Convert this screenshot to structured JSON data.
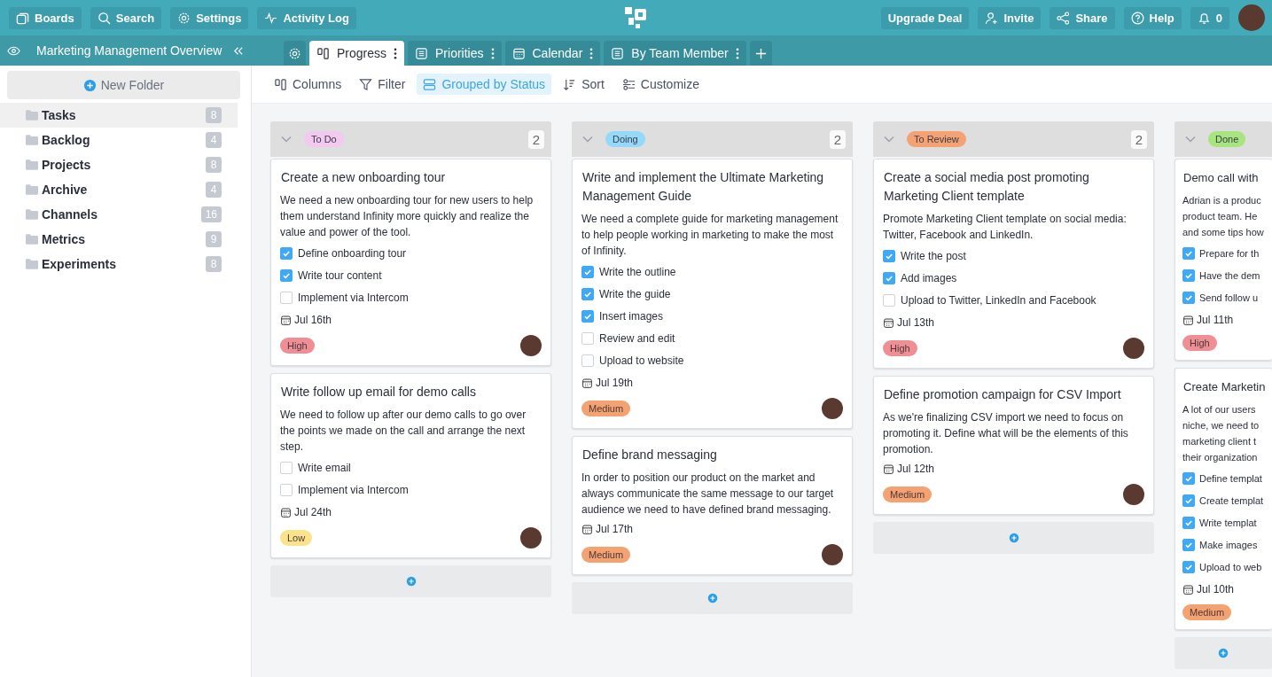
{
  "topbar": {
    "left": [
      {
        "label": "Boards",
        "kind": "boards"
      },
      {
        "label": "Search",
        "kind": "search"
      },
      {
        "label": "Settings",
        "kind": "settings"
      },
      {
        "label": "Activity Log",
        "kind": "activity"
      }
    ],
    "right": [
      {
        "label": "Upgrade Deal",
        "kind": "plain"
      },
      {
        "label": "Invite",
        "kind": "invite"
      },
      {
        "label": "Share",
        "kind": "share"
      },
      {
        "label": "Help",
        "kind": "help"
      },
      {
        "label": "0",
        "kind": "bell"
      }
    ]
  },
  "workspace": {
    "title": "Marketing Management Overview"
  },
  "tabs": [
    {
      "label": "Progress",
      "kind": "board",
      "selected": true
    },
    {
      "label": "Priorities",
      "kind": "list",
      "selected": false
    },
    {
      "label": "Calendar",
      "kind": "calendar",
      "selected": false
    },
    {
      "label": "By Team Member",
      "kind": "list",
      "selected": false
    }
  ],
  "sidebar": {
    "new_folder": "New Folder",
    "items": [
      {
        "label": "Tasks",
        "count": "8",
        "selected": true
      },
      {
        "label": "Backlog",
        "count": "4",
        "selected": false
      },
      {
        "label": "Projects",
        "count": "8",
        "selected": false
      },
      {
        "label": "Archive",
        "count": "4",
        "selected": false
      },
      {
        "label": "Channels",
        "count": "16",
        "selected": false
      },
      {
        "label": "Metrics",
        "count": "9",
        "selected": false
      },
      {
        "label": "Experiments",
        "count": "8",
        "selected": false
      }
    ]
  },
  "toolbar": [
    {
      "label": "Columns",
      "kind": "columns",
      "selected": false
    },
    {
      "label": "Filter",
      "kind": "filter",
      "selected": false
    },
    {
      "label": "Grouped by Status",
      "kind": "group",
      "selected": true
    },
    {
      "label": "Sort",
      "kind": "sort",
      "selected": false
    },
    {
      "label": "Customize",
      "kind": "customize",
      "selected": false
    }
  ],
  "columns": [
    {
      "status": "To Do",
      "color": "#f3c9ef",
      "count": "2",
      "cards": [
        {
          "title": "Create a new onboarding tour",
          "description": [
            "We need a new onboarding tour for new users to help them understand Infinity more quickly and realize the value and power of the tool."
          ],
          "checklist": [
            {
              "label": "Define onboarding tour",
              "checked": true
            },
            {
              "label": "Write tour content",
              "checked": true
            },
            {
              "label": "Implement via Intercom",
              "checked": false
            }
          ],
          "date": "Jul 16th",
          "priority": {
            "label": "High",
            "color": "#ef8f95"
          }
        },
        {
          "title": "Write follow up email for demo calls",
          "description": [
            "We need to follow up after our demo calls to go over the points we made on the call and arrange the next step."
          ],
          "checklist": [
            {
              "label": "Write email",
              "checked": false
            },
            {
              "label": "Implement via Intercom",
              "checked": false
            }
          ],
          "date": "Jul 24th",
          "priority": {
            "label": "Low",
            "color": "#fbe38e"
          }
        }
      ]
    },
    {
      "status": "Doing",
      "color": "#94d9f7",
      "count": "2",
      "cards": [
        {
          "title": "Write and implement the Ultimate Marketing Management Guide",
          "description": [
            "We need a complete guide for marketing management to help people working in marketing to make the most of Infinity."
          ],
          "checklist": [
            {
              "label": "Write the outline",
              "checked": true
            },
            {
              "label": "Write the guide",
              "checked": true
            },
            {
              "label": "Insert images",
              "checked": true
            },
            {
              "label": "Review and edit",
              "checked": false
            },
            {
              "label": "Upload to website",
              "checked": false
            }
          ],
          "date": "Jul 19th",
          "priority": {
            "label": "Medium",
            "color": "#f4a272"
          }
        },
        {
          "title": "Define brand messaging",
          "description": [
            "In order to position our product on the market and always communicate the same message to our target audience we need to have defined brand messaging."
          ],
          "date": "Jul 17th",
          "priority": {
            "label": "Medium",
            "color": "#f4a272"
          }
        }
      ]
    },
    {
      "status": "To Review",
      "color": "#f4a272",
      "count": "2",
      "cards": [
        {
          "title": "Create a social media post promoting Marketing Client template",
          "description": [
            "Promote Marketing Client template on social media: Twitter, Facebook and LinkedIn."
          ],
          "checklist": [
            {
              "label": "Write the post",
              "checked": true
            },
            {
              "label": "Add images",
              "checked": true
            },
            {
              "label": "Upload to Twitter, LinkedIn and Facebook",
              "checked": false
            }
          ],
          "date": "Jul 13th",
          "priority": {
            "label": "High",
            "color": "#ef8f95"
          }
        },
        {
          "title": "Define promotion campaign for CSV Import",
          "description": [
            "As we're finalizing CSV import we need to focus on promoting it. Define what will be the elements of this promotion."
          ],
          "date": "Jul 12th",
          "priority": {
            "label": "Medium",
            "color": "#f4a272"
          }
        }
      ]
    },
    {
      "status": "Done",
      "color": "#a8e57e",
      "cards": [
        {
          "title": "Demo call with",
          "description": [
            "Adrian is a produc",
            "product team. He",
            "and some tips how"
          ],
          "checklist": [
            {
              "label": "Prepare for th",
              "checked": true
            },
            {
              "label": "Have the dem",
              "checked": true
            },
            {
              "label": "Send follow u",
              "checked": true
            }
          ],
          "date": "Jul 11th",
          "priority": {
            "label": "High",
            "color": "#ef8f95"
          }
        },
        {
          "title": "Create Marketin",
          "description": [
            "A lot of our users",
            "niche, we need to",
            "marketing client t",
            "their organization"
          ],
          "checklist": [
            {
              "label": "Define templat",
              "checked": true
            },
            {
              "label": "Create templat",
              "checked": true
            },
            {
              "label": "Write templat",
              "checked": true
            },
            {
              "label": "Make images",
              "checked": true
            },
            {
              "label": "Upload to web",
              "checked": true
            }
          ],
          "date": "Jul 10th",
          "priority": {
            "label": "Medium",
            "color": "#f4a272"
          }
        }
      ]
    }
  ]
}
